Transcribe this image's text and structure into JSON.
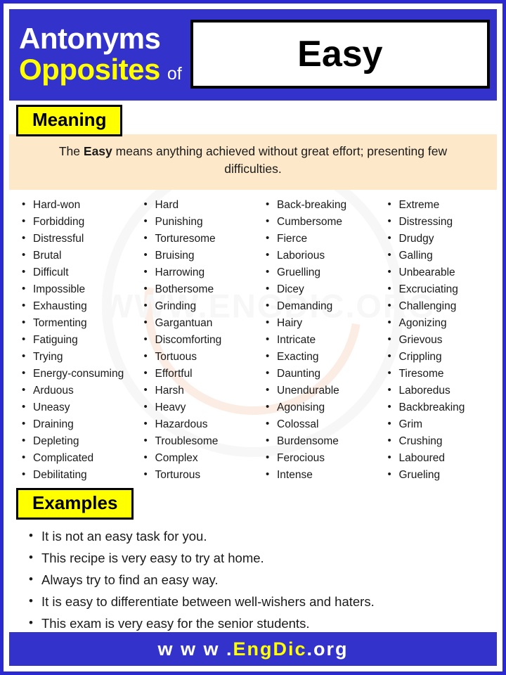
{
  "header": {
    "line1": "Antonyms",
    "line2": "Opposites",
    "of": "of",
    "word": "Easy"
  },
  "meaning": {
    "label": "Meaning",
    "text_before": "The ",
    "text_bold": "Easy",
    "text_after": " means anything achieved without great effort; presenting few difficulties."
  },
  "columns": [
    {
      "items": [
        "Hard-won",
        "Forbidding",
        "Distressful",
        "Brutal",
        "Difficult",
        "Impossible",
        "Exhausting",
        "Tormenting",
        "Fatiguing",
        "Trying",
        "Energy-consuming",
        "Arduous",
        "Uneasy",
        "Draining",
        "Depleting",
        "Complicated",
        "Debilitating"
      ]
    },
    {
      "items": [
        "Hard",
        "Punishing",
        "Torturesome",
        "Bruising",
        "Harrowing",
        "Bothersome",
        "Grinding",
        "Gargantuan",
        "Discomforting",
        "Tortuous",
        "Effortful",
        "Harsh",
        "Heavy",
        "Hazardous",
        "Troublesome",
        "Complex",
        "Torturous"
      ]
    },
    {
      "items": [
        "Back-breaking",
        "Cumbersome",
        "Fierce",
        "Laborious",
        "Gruelling",
        "Dicey",
        "Demanding",
        "Hairy",
        "Intricate",
        "Exacting",
        "Daunting",
        "Unendurable",
        "Agonising",
        "Colossal",
        "Burdensome",
        "Ferocious",
        "Intense"
      ]
    },
    {
      "items": [
        "Extreme",
        "Distressing",
        "Drudgy",
        "Galling",
        "Unbearable",
        "Excruciating",
        "Challenging",
        "Agonizing",
        "Grievous",
        "Crippling",
        "Tiresome",
        "Laboredus",
        "Backbreaking",
        "Grim",
        "Crushing",
        "Laboured",
        "Grueling"
      ]
    }
  ],
  "examples": {
    "label": "Examples",
    "items": [
      "It is not an easy task for you.",
      "This recipe is very easy to try at home.",
      "Always try to find an easy way.",
      "It is easy to differentiate between well-wishers and haters.",
      "This exam is very easy for the senior students."
    ]
  },
  "footer": {
    "prefix": "w w w .",
    "brand": "EngDic",
    "suffix": ".org"
  },
  "watermark": {
    "text": "WWW.ENGDIC.ORG"
  },
  "colors": {
    "brand_blue": "#3333cc",
    "accent_yellow": "#ffff00",
    "meaning_bg": "#fde9c9"
  }
}
